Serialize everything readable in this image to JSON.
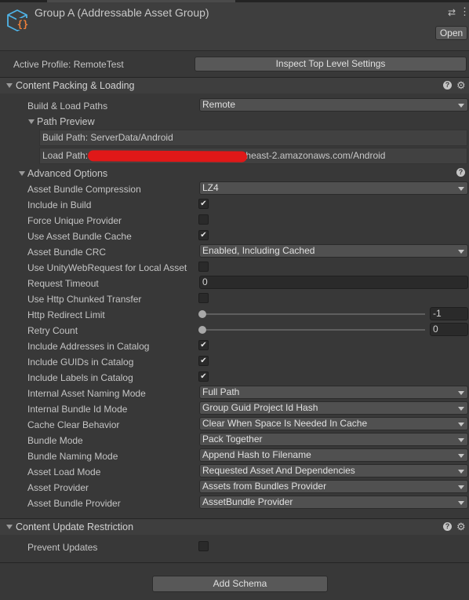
{
  "header": {
    "title": "Group A (Addressable Asset Group)",
    "open_label": "Open"
  },
  "profile": {
    "label": "Active Profile: RemoteTest",
    "inspect_label": "Inspect Top Level Settings"
  },
  "content_packing": {
    "title": "Content Packing & Loading",
    "build_load_paths_label": "Build & Load Paths",
    "build_load_paths_value": "Remote",
    "path_preview_label": "Path Preview",
    "build_path": "Build Path: ServerData/Android",
    "load_path_prefix": "Load Path: ",
    "load_path_suffix": "heast-2.amazonaws.com/Android"
  },
  "advanced": {
    "title": "Advanced Options",
    "asset_bundle_compression": {
      "label": "Asset Bundle Compression",
      "value": "LZ4"
    },
    "include_in_build": {
      "label": "Include in Build",
      "checked": true
    },
    "force_unique_provider": {
      "label": "Force Unique Provider",
      "checked": false
    },
    "use_asset_bundle_cache": {
      "label": "Use Asset Bundle Cache",
      "checked": true
    },
    "asset_bundle_crc": {
      "label": "Asset Bundle CRC",
      "value": "Enabled, Including Cached"
    },
    "use_unitywebrequest": {
      "label": "Use UnityWebRequest for Local Asset",
      "checked": false
    },
    "request_timeout": {
      "label": "Request Timeout",
      "value": "0"
    },
    "use_http_chunked": {
      "label": "Use Http Chunked Transfer",
      "checked": false
    },
    "http_redirect_limit": {
      "label": "Http Redirect Limit",
      "value": "-1"
    },
    "retry_count": {
      "label": "Retry Count",
      "value": "0"
    },
    "include_addresses": {
      "label": "Include Addresses in Catalog",
      "checked": true
    },
    "include_guids": {
      "label": "Include GUIDs in Catalog",
      "checked": true
    },
    "include_labels": {
      "label": "Include Labels in Catalog",
      "checked": true
    },
    "internal_asset_naming": {
      "label": "Internal Asset Naming Mode",
      "value": "Full Path"
    },
    "internal_bundle_id": {
      "label": "Internal Bundle Id Mode",
      "value": "Group Guid Project Id Hash"
    },
    "cache_clear": {
      "label": "Cache Clear Behavior",
      "value": "Clear When Space Is Needed In Cache"
    },
    "bundle_mode": {
      "label": "Bundle Mode",
      "value": "Pack Together"
    },
    "bundle_naming": {
      "label": "Bundle Naming Mode",
      "value": "Append Hash to Filename"
    },
    "asset_load_mode": {
      "label": "Asset Load Mode",
      "value": "Requested Asset And Dependencies"
    },
    "asset_provider": {
      "label": "Asset Provider",
      "value": "Assets from Bundles Provider"
    },
    "asset_bundle_provider": {
      "label": "Asset Bundle Provider",
      "value": "AssetBundle Provider"
    }
  },
  "content_update": {
    "title": "Content Update Restriction",
    "prevent_updates": {
      "label": "Prevent Updates",
      "checked": false
    }
  },
  "footer": {
    "add_schema_label": "Add Schema"
  },
  "icons": {
    "group": "addressable-group-icon",
    "filter": "filter-icon",
    "menu": "kebab-menu-icon",
    "help": "help-icon",
    "settings": "gear-icon",
    "checkmark": "checkmark-icon",
    "dropdown": "chevron-down-icon",
    "foldout": "triangle-down-icon"
  },
  "colors": {
    "background": "#383838",
    "header": "#3e3e3e",
    "button": "#585858",
    "field": "#2a2a2a",
    "redaction": "#e01818"
  }
}
